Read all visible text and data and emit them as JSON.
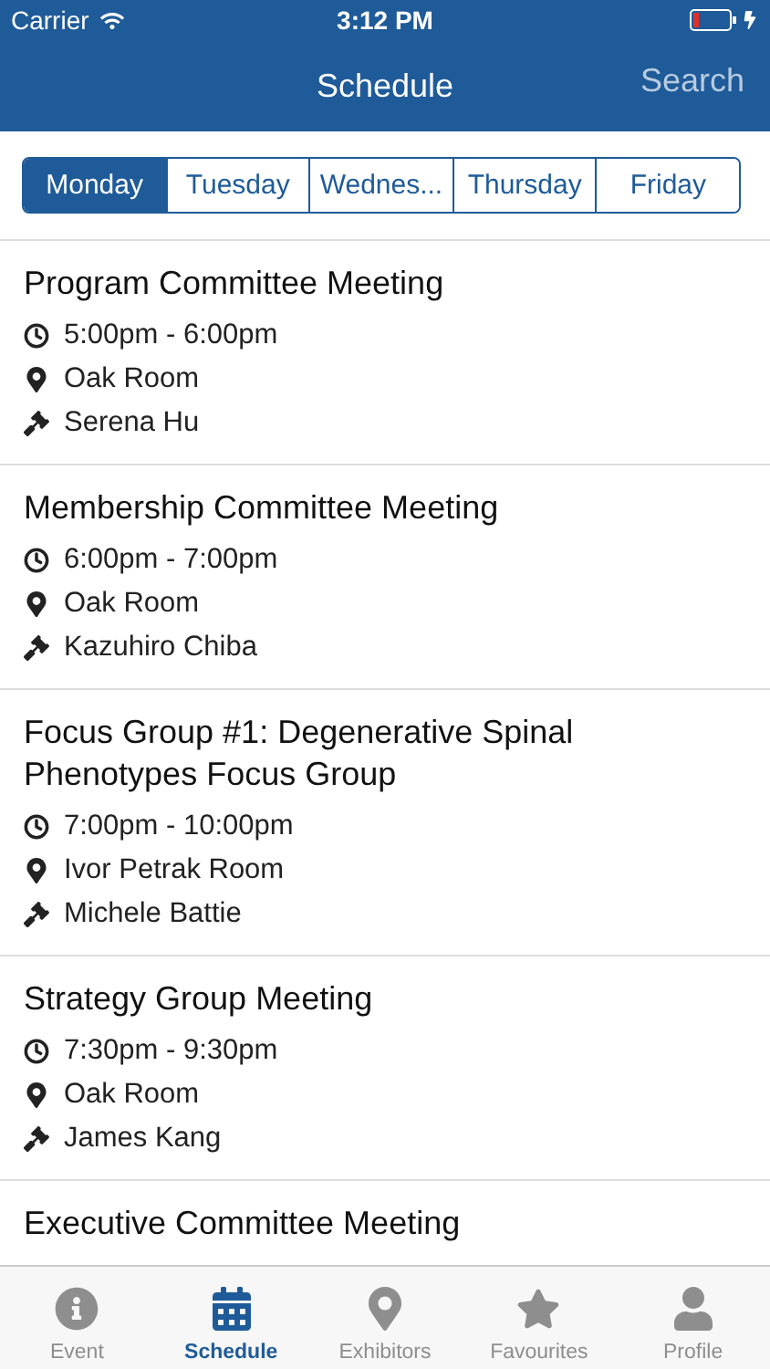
{
  "status_bar": {
    "carrier": "Carrier",
    "time": "3:12 PM"
  },
  "nav": {
    "title": "Schedule",
    "action": "Search"
  },
  "days": [
    {
      "label": "Monday",
      "selected": true
    },
    {
      "label": "Tuesday",
      "selected": false
    },
    {
      "label": "Wednes...",
      "selected": false
    },
    {
      "label": "Thursday",
      "selected": false
    },
    {
      "label": "Friday",
      "selected": false
    }
  ],
  "sessions": [
    {
      "title": "Program Committee Meeting",
      "time": "5:00pm - 6:00pm",
      "room": "Oak Room",
      "chair": "Serena Hu"
    },
    {
      "title": "Membership Committee Meeting",
      "time": "6:00pm - 7:00pm",
      "room": "Oak Room",
      "chair": "Kazuhiro Chiba"
    },
    {
      "title": "Focus Group #1: Degenerative Spinal Phenotypes Focus Group",
      "time": "7:00pm - 10:00pm",
      "room": "Ivor Petrak Room",
      "chair": "Michele Battie"
    },
    {
      "title": "Strategy Group Meeting",
      "time": "7:30pm - 9:30pm",
      "room": "Oak Room",
      "chair": "James Kang"
    },
    {
      "title": "Executive Committee Meeting"
    }
  ],
  "tab_bar": [
    {
      "kind": "info",
      "label": "Event",
      "selected": false
    },
    {
      "kind": "calendar",
      "label": "Schedule",
      "selected": true
    },
    {
      "kind": "pin",
      "label": "Exhibitors",
      "selected": false
    },
    {
      "kind": "star",
      "label": "Favourites",
      "selected": false
    },
    {
      "kind": "person",
      "label": "Profile",
      "selected": false
    }
  ]
}
